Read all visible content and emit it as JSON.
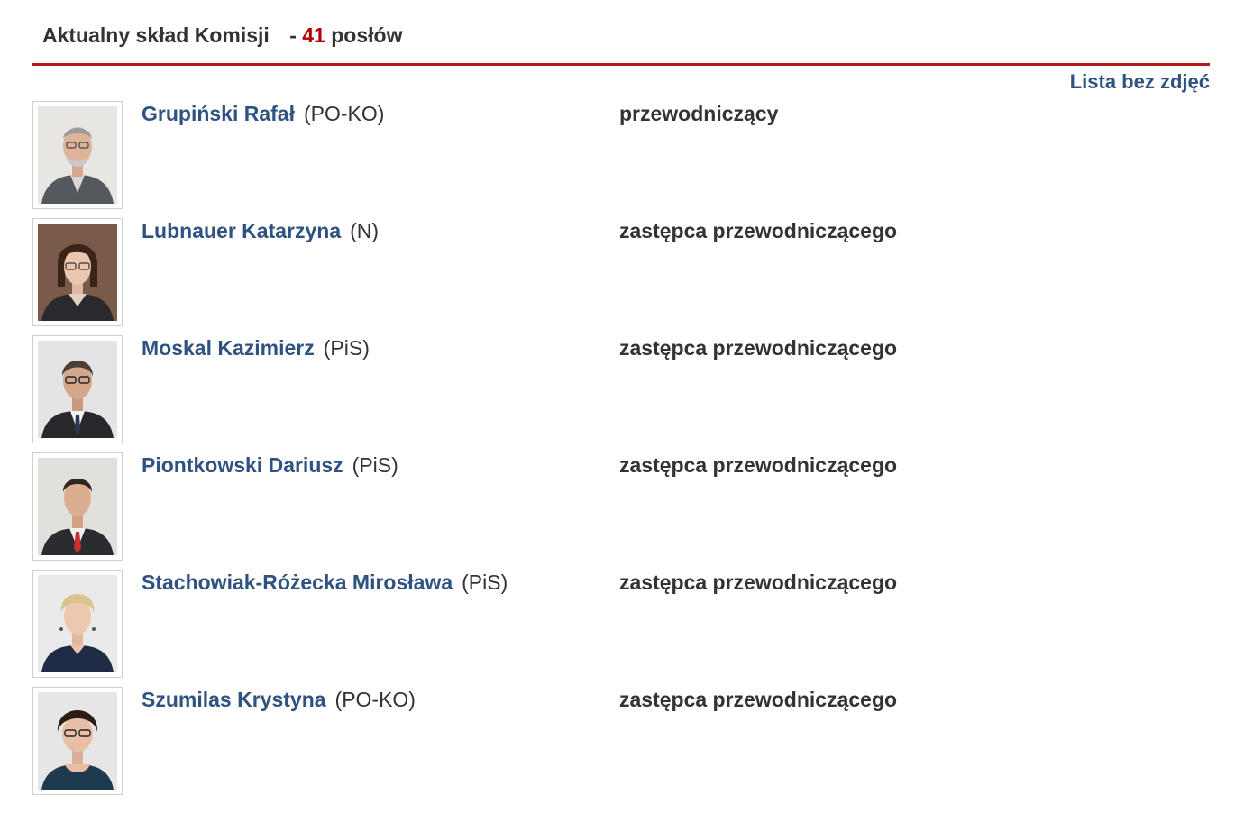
{
  "header": {
    "title": "Aktualny skład Komisji",
    "separator": "-",
    "count": "41",
    "count_suffix": "posłów"
  },
  "colors": {
    "accent_red": "#b31b1b",
    "link_blue": "#2e5281",
    "text": "#333333"
  },
  "list_toggle_label": "Lista bez zdjęć",
  "members": [
    {
      "name": "Grupiński Rafał",
      "club": "(PO-KO)",
      "role": "przewodniczący"
    },
    {
      "name": "Lubnauer Katarzyna",
      "club": "(N)",
      "role": "zastępca przewodniczącego"
    },
    {
      "name": "Moskal Kazimierz",
      "club": "(PiS)",
      "role": "zastępca przewodniczącego"
    },
    {
      "name": "Piontkowski Dariusz",
      "club": "(PiS)",
      "role": "zastępca przewodniczącego"
    },
    {
      "name": "Stachowiak-Różecka Mirosława",
      "club": "(PiS)",
      "role": "zastępca przewodniczącego"
    },
    {
      "name": "Szumilas Krystyna",
      "club": "(PO-KO)",
      "role": "zastępca przewodniczącego"
    }
  ]
}
